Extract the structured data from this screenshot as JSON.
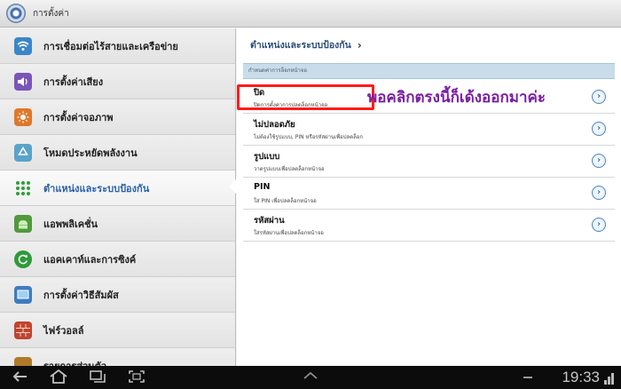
{
  "header": {
    "title": "การตั้งค่า"
  },
  "sidebar": {
    "items": [
      {
        "label": "การเชื่อมต่อไร้สายและเครือข่าย",
        "icon": "wifi-icon",
        "color": "#3a86c8"
      },
      {
        "label": "การตั้งค่าเสียง",
        "icon": "speaker-icon",
        "color": "#7a55b8"
      },
      {
        "label": "การตั้งค่าจอภาพ",
        "icon": "brightness-icon",
        "color": "#e0772a"
      },
      {
        "label": "โหมดประหยัดพลังงาน",
        "icon": "recycle-icon",
        "color": "#5aa3c8"
      },
      {
        "label": "ตำแหน่งและระบบป้องกัน",
        "icon": "grid-dots-icon",
        "color": "#3aa23a"
      },
      {
        "label": "แอพพลิเคชั่น",
        "icon": "android-icon",
        "color": "#4f9a3c"
      },
      {
        "label": "แอคเคาท์และการซิงค์",
        "icon": "sync-icon",
        "color": "#2f9a3a"
      },
      {
        "label": "การตั้งค่าวิธีสัมผัส",
        "icon": "screen-icon",
        "color": "#3e7bc0"
      },
      {
        "label": "ไฟร์วอลล์",
        "icon": "brick-wall-icon",
        "color": "#c0442f"
      },
      {
        "label": "รายการส่วนตัว",
        "icon": "briefcase-icon",
        "color": "#b07a2a"
      }
    ],
    "active_index": 4
  },
  "main": {
    "breadcrumb": "ตำแหน่งและระบบป้องกัน",
    "section_header": "กำหนดค่าการล็อกหน้าจอ",
    "options": [
      {
        "title": "ปิด",
        "desc": "ปิดการตั้งค่าการปลดล็อกหน้าจอ"
      },
      {
        "title": "ไม่ปลอดภัย",
        "desc": "ไม่ต้องใช้รูปแบบ, PIN หรือรหัสผ่านเพื่อปลดล็อก"
      },
      {
        "title": "รูปแบบ",
        "desc": "วาดรูปแบบเพื่อปลดล็อกหน้าจอ"
      },
      {
        "title": "PIN",
        "desc": "ใส่ PIN เพื่อปลดล็อกหน้าจอ"
      },
      {
        "title": "รหัสผ่าน",
        "desc": "ใส่รหัสผ่านเพื่อปลดล็อกหน้าจอ"
      }
    ]
  },
  "annotation": {
    "text": "พอคลิกตรงนี้ก็เด้งออกมาค่ะ",
    "color": "#7a1fa2",
    "box_color": "#ff1a1a"
  },
  "navbar": {
    "time": "19:33"
  }
}
